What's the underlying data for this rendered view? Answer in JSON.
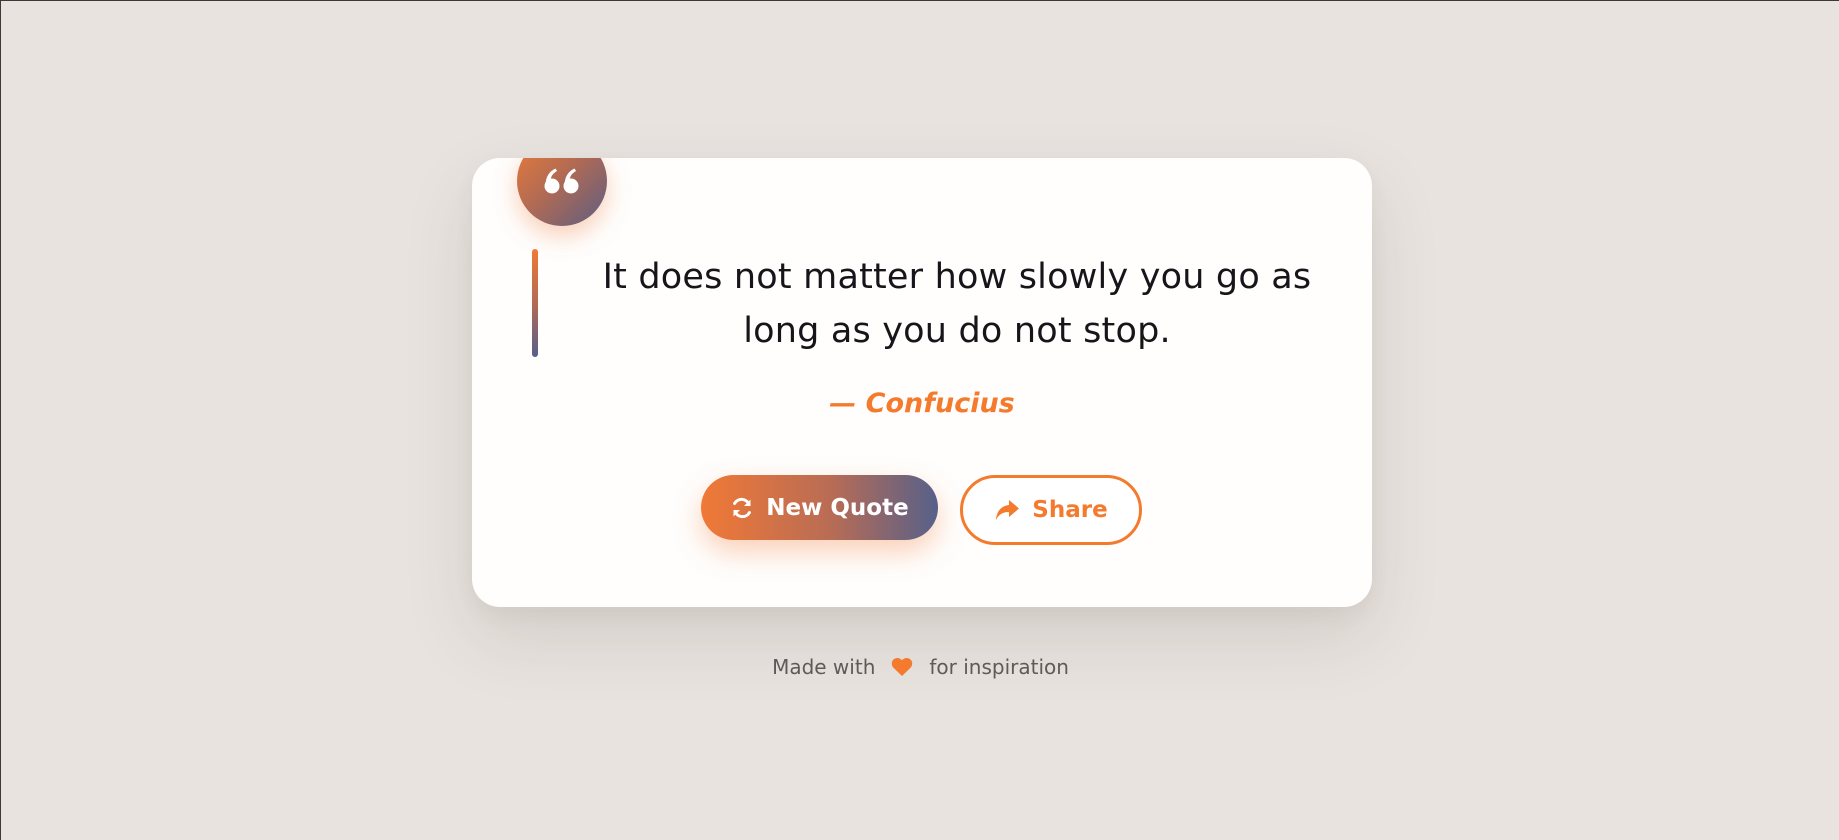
{
  "quote": {
    "text": "It does not matter how slowly you go as long as you do not stop.",
    "author": "— Confucius"
  },
  "actions": {
    "new_quote_label": "New Quote",
    "share_label": "Share"
  },
  "footer": {
    "prefix": "Made with",
    "suffix": "for inspiration"
  },
  "icons": {
    "badge": "quote-left-icon",
    "new_quote": "refresh-icon",
    "share": "share-arrow-icon",
    "footer": "heart-icon"
  },
  "colors": {
    "accent": "#f47a2d",
    "gradient_end": "#56608a",
    "background": "#e8e3df",
    "card": "#fffefd"
  }
}
